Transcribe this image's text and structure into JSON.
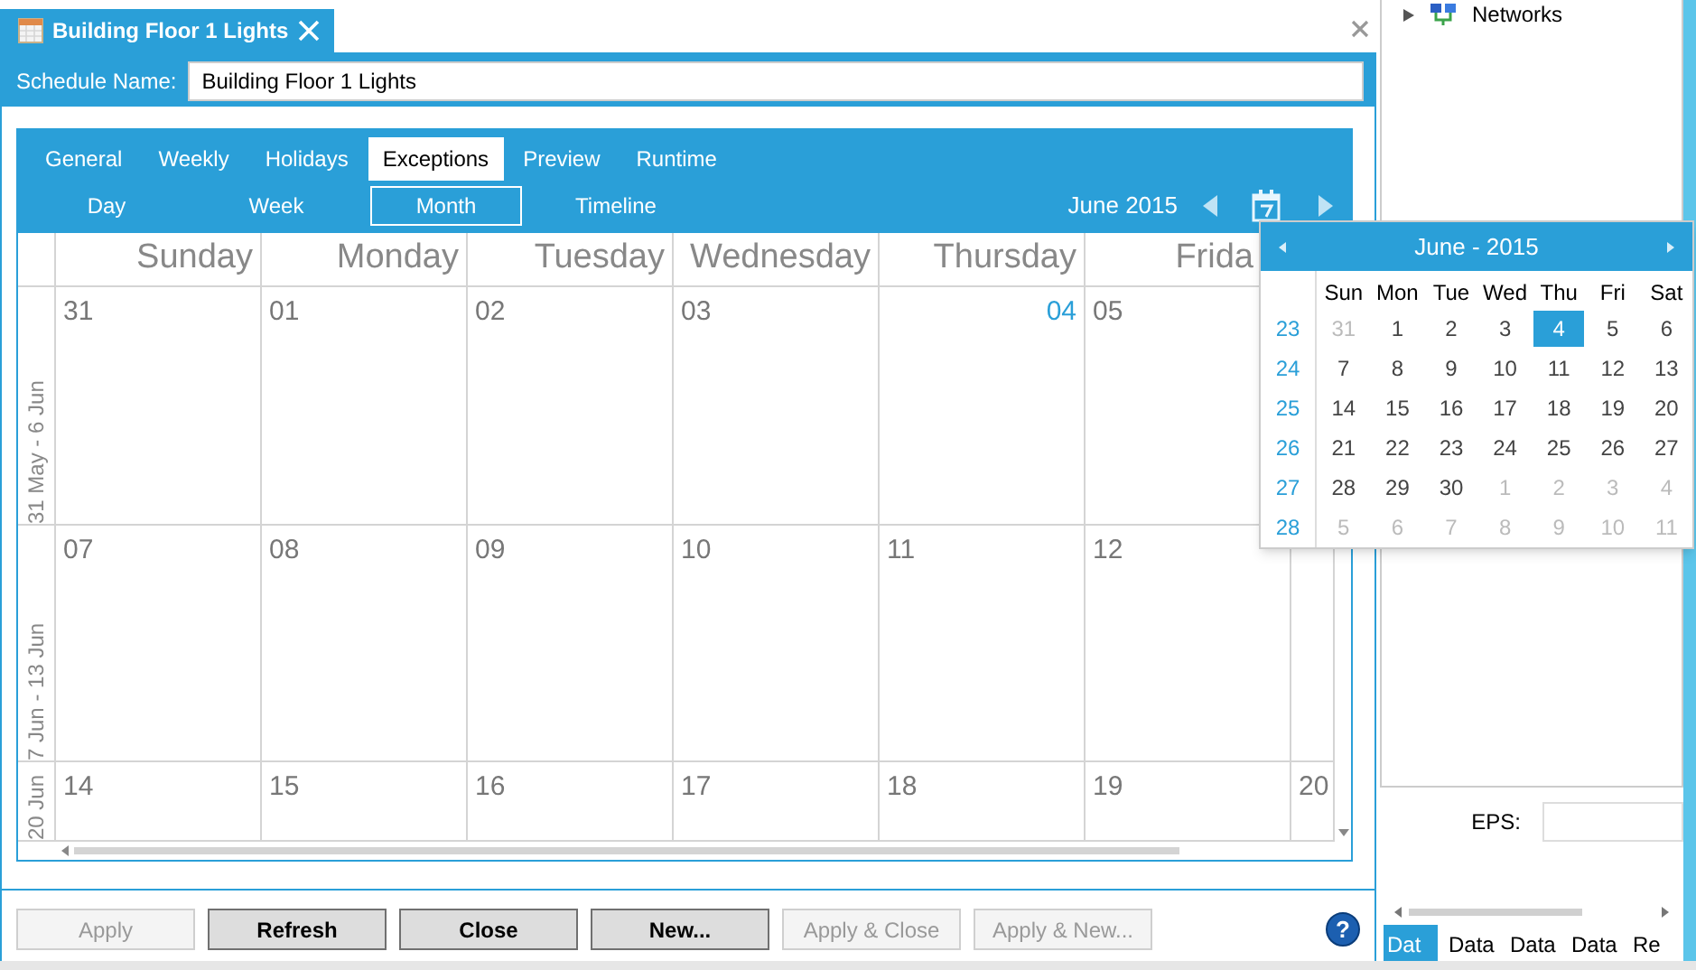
{
  "document_tab": {
    "title": "Building Floor 1 Lights"
  },
  "schedule_name": {
    "label": "Schedule Name:",
    "value": "Building Floor 1 Lights"
  },
  "tabs": [
    {
      "label": "General",
      "selected": false
    },
    {
      "label": "Weekly",
      "selected": false
    },
    {
      "label": "Holidays",
      "selected": false
    },
    {
      "label": "Exceptions",
      "selected": true
    },
    {
      "label": "Preview",
      "selected": false
    },
    {
      "label": "Runtime",
      "selected": false
    }
  ],
  "views": [
    {
      "label": "Day",
      "selected": false
    },
    {
      "label": "Week",
      "selected": false
    },
    {
      "label": "Month",
      "selected": true
    },
    {
      "label": "Timeline",
      "selected": false
    }
  ],
  "period": "June 2015",
  "calendar": {
    "columns": [
      "Sunday",
      "Monday",
      "Tuesday",
      "Wednesday",
      "Thursday",
      "Frida"
    ],
    "weeks": [
      {
        "label": "31 May - 6 Jun",
        "days": [
          {
            "text": "31",
            "today": false
          },
          {
            "text": "01",
            "today": false
          },
          {
            "text": "02",
            "today": false
          },
          {
            "text": "03",
            "today": false
          },
          {
            "text": "04",
            "today": true
          },
          {
            "text": "05",
            "today": false
          }
        ]
      },
      {
        "label": "7 Jun - 13 Jun",
        "days": [
          {
            "text": "07",
            "today": false
          },
          {
            "text": "08",
            "today": false
          },
          {
            "text": "09",
            "today": false
          },
          {
            "text": "10",
            "today": false
          },
          {
            "text": "11",
            "today": false
          },
          {
            "text": "12",
            "today": false
          }
        ]
      },
      {
        "label": "20 Jun",
        "days": [
          {
            "text": "14",
            "today": false
          },
          {
            "text": "15",
            "today": false
          },
          {
            "text": "16",
            "today": false
          },
          {
            "text": "17",
            "today": false
          },
          {
            "text": "18",
            "today": false
          },
          {
            "text": "19",
            "today": false
          },
          {
            "text": "20",
            "today": false
          }
        ]
      }
    ]
  },
  "date_picker": {
    "title": "June - 2015",
    "weekdays": [
      "Sun",
      "Mon",
      "Tue",
      "Wed",
      "Thu",
      "Fri",
      "Sat"
    ],
    "weeks": [
      {
        "number": "23",
        "days": [
          {
            "text": "31",
            "outside": true,
            "selected": false
          },
          {
            "text": "1",
            "outside": false,
            "selected": false
          },
          {
            "text": "2",
            "outside": false,
            "selected": false
          },
          {
            "text": "3",
            "outside": false,
            "selected": false
          },
          {
            "text": "4",
            "outside": false,
            "selected": true
          },
          {
            "text": "5",
            "outside": false,
            "selected": false
          },
          {
            "text": "6",
            "outside": false,
            "selected": false
          }
        ]
      },
      {
        "number": "24",
        "days": [
          {
            "text": "7",
            "outside": false,
            "selected": false
          },
          {
            "text": "8",
            "outside": false,
            "selected": false
          },
          {
            "text": "9",
            "outside": false,
            "selected": false
          },
          {
            "text": "10",
            "outside": false,
            "selected": false
          },
          {
            "text": "11",
            "outside": false,
            "selected": false
          },
          {
            "text": "12",
            "outside": false,
            "selected": false
          },
          {
            "text": "13",
            "outside": false,
            "selected": false
          }
        ]
      },
      {
        "number": "25",
        "days": [
          {
            "text": "14",
            "outside": false,
            "selected": false
          },
          {
            "text": "15",
            "outside": false,
            "selected": false
          },
          {
            "text": "16",
            "outside": false,
            "selected": false
          },
          {
            "text": "17",
            "outside": false,
            "selected": false
          },
          {
            "text": "18",
            "outside": false,
            "selected": false
          },
          {
            "text": "19",
            "outside": false,
            "selected": false
          },
          {
            "text": "20",
            "outside": false,
            "selected": false
          }
        ]
      },
      {
        "number": "26",
        "days": [
          {
            "text": "21",
            "outside": false,
            "selected": false
          },
          {
            "text": "22",
            "outside": false,
            "selected": false
          },
          {
            "text": "23",
            "outside": false,
            "selected": false
          },
          {
            "text": "24",
            "outside": false,
            "selected": false
          },
          {
            "text": "25",
            "outside": false,
            "selected": false
          },
          {
            "text": "26",
            "outside": false,
            "selected": false
          },
          {
            "text": "27",
            "outside": false,
            "selected": false
          }
        ]
      },
      {
        "number": "27",
        "days": [
          {
            "text": "28",
            "outside": false,
            "selected": false
          },
          {
            "text": "29",
            "outside": false,
            "selected": false
          },
          {
            "text": "30",
            "outside": false,
            "selected": false
          },
          {
            "text": "1",
            "outside": true,
            "selected": false
          },
          {
            "text": "2",
            "outside": true,
            "selected": false
          },
          {
            "text": "3",
            "outside": true,
            "selected": false
          },
          {
            "text": "4",
            "outside": true,
            "selected": false
          }
        ]
      },
      {
        "number": "28",
        "days": [
          {
            "text": "5",
            "outside": true,
            "selected": false
          },
          {
            "text": "6",
            "outside": true,
            "selected": false
          },
          {
            "text": "7",
            "outside": true,
            "selected": false
          },
          {
            "text": "8",
            "outside": true,
            "selected": false
          },
          {
            "text": "9",
            "outside": true,
            "selected": false
          },
          {
            "text": "10",
            "outside": true,
            "selected": false
          },
          {
            "text": "11",
            "outside": true,
            "selected": false
          }
        ]
      }
    ]
  },
  "buttons": [
    {
      "label": "Apply",
      "disabled": true
    },
    {
      "label": "Refresh",
      "disabled": false
    },
    {
      "label": "Close",
      "disabled": false
    },
    {
      "label": "New...",
      "disabled": false
    },
    {
      "label": "Apply & Close",
      "disabled": true
    },
    {
      "label": "Apply & New...",
      "disabled": true
    }
  ],
  "help": "?",
  "tree": {
    "items": [
      {
        "label": "Networks",
        "expanded": false
      }
    ]
  },
  "eps": {
    "label": "EPS:"
  },
  "bottom_tabs": [
    {
      "label": "Dat",
      "selected": true
    },
    {
      "label": "Data",
      "selected": false
    },
    {
      "label": "Data",
      "selected": false
    },
    {
      "label": "Data",
      "selected": false
    },
    {
      "label": "Re",
      "selected": false
    }
  ]
}
